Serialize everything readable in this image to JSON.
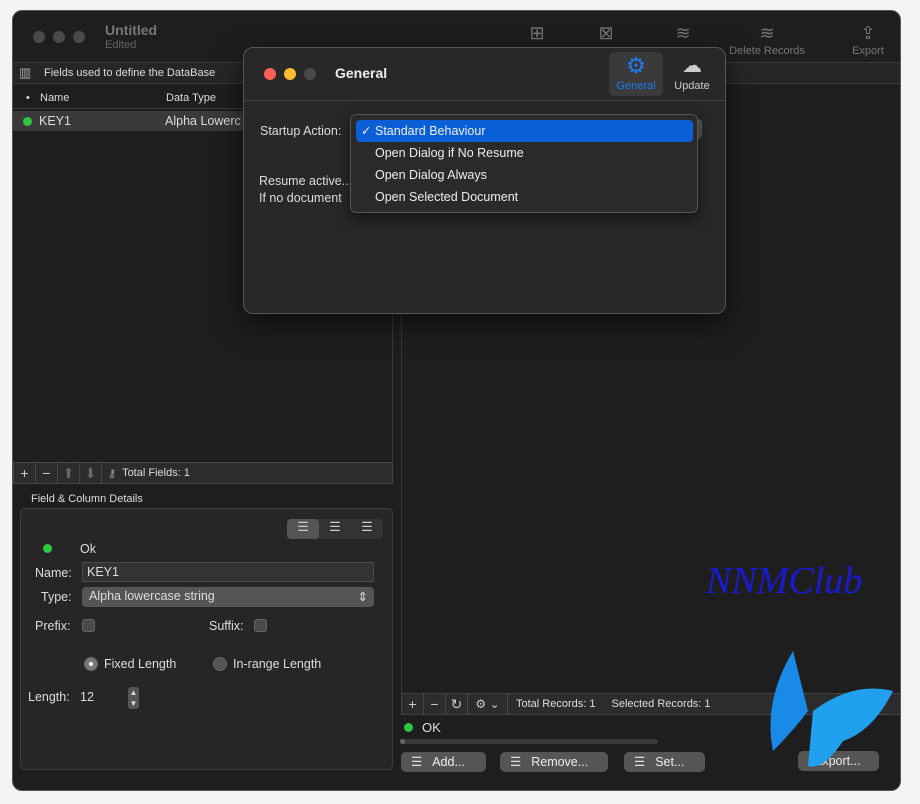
{
  "window": {
    "title": "Untitled",
    "subtitle": "Edited"
  },
  "toolbar": {
    "items": [
      {
        "label": "",
        "icon": "add-field-icon"
      },
      {
        "label": "",
        "icon": "remove-field-icon"
      },
      {
        "label": "",
        "icon": "add-records-icon"
      },
      {
        "label": "Delete Records",
        "icon": "delete-records-icon"
      },
      {
        "label": "Export",
        "icon": "share-icon"
      }
    ]
  },
  "fields_panel": {
    "title": "Fields used to define the DataBase",
    "columns": [
      "•",
      "Name",
      "Data Type"
    ],
    "rows": [
      {
        "name": "KEY1",
        "type": "Alpha Lowerc"
      }
    ],
    "total": "Total Fields: 1"
  },
  "details": {
    "title": "Field & Column Details",
    "status": "Ok",
    "name_label": "Name:",
    "name_value": "KEY1",
    "type_label": "Type:",
    "type_value": "Alpha lowercase string",
    "prefix_label": "Prefix:",
    "suffix_label": "Suffix:",
    "fixed_label": "Fixed Length",
    "range_label": "In-range Length",
    "length_label": "Length:",
    "length_value": "12"
  },
  "records": {
    "total": "Total Records: 1",
    "selected": "Selected Records: 1",
    "status": "OK",
    "progress": 0,
    "buttons": {
      "add": "Add...",
      "remove": "Remove...",
      "set": "Set...",
      "export": "Export..."
    }
  },
  "watermark": "NNMClub",
  "prefs": {
    "title": "General",
    "tabs": [
      {
        "label": "General",
        "active": true
      },
      {
        "label": "Update",
        "active": false
      }
    ],
    "startup_label": "Startup Action:",
    "resume_text_1": "Resume active...",
    "resume_text_2": "If no document",
    "menu": {
      "selected": "Standard Behaviour",
      "options": [
        "Standard Behaviour",
        "Open Dialog if No Resume",
        "Open Dialog Always",
        "Open Selected Document"
      ]
    }
  },
  "colors": {
    "accent": "#0a5fd6",
    "ok": "#2bc840",
    "watermark": "#1a1ad0"
  }
}
